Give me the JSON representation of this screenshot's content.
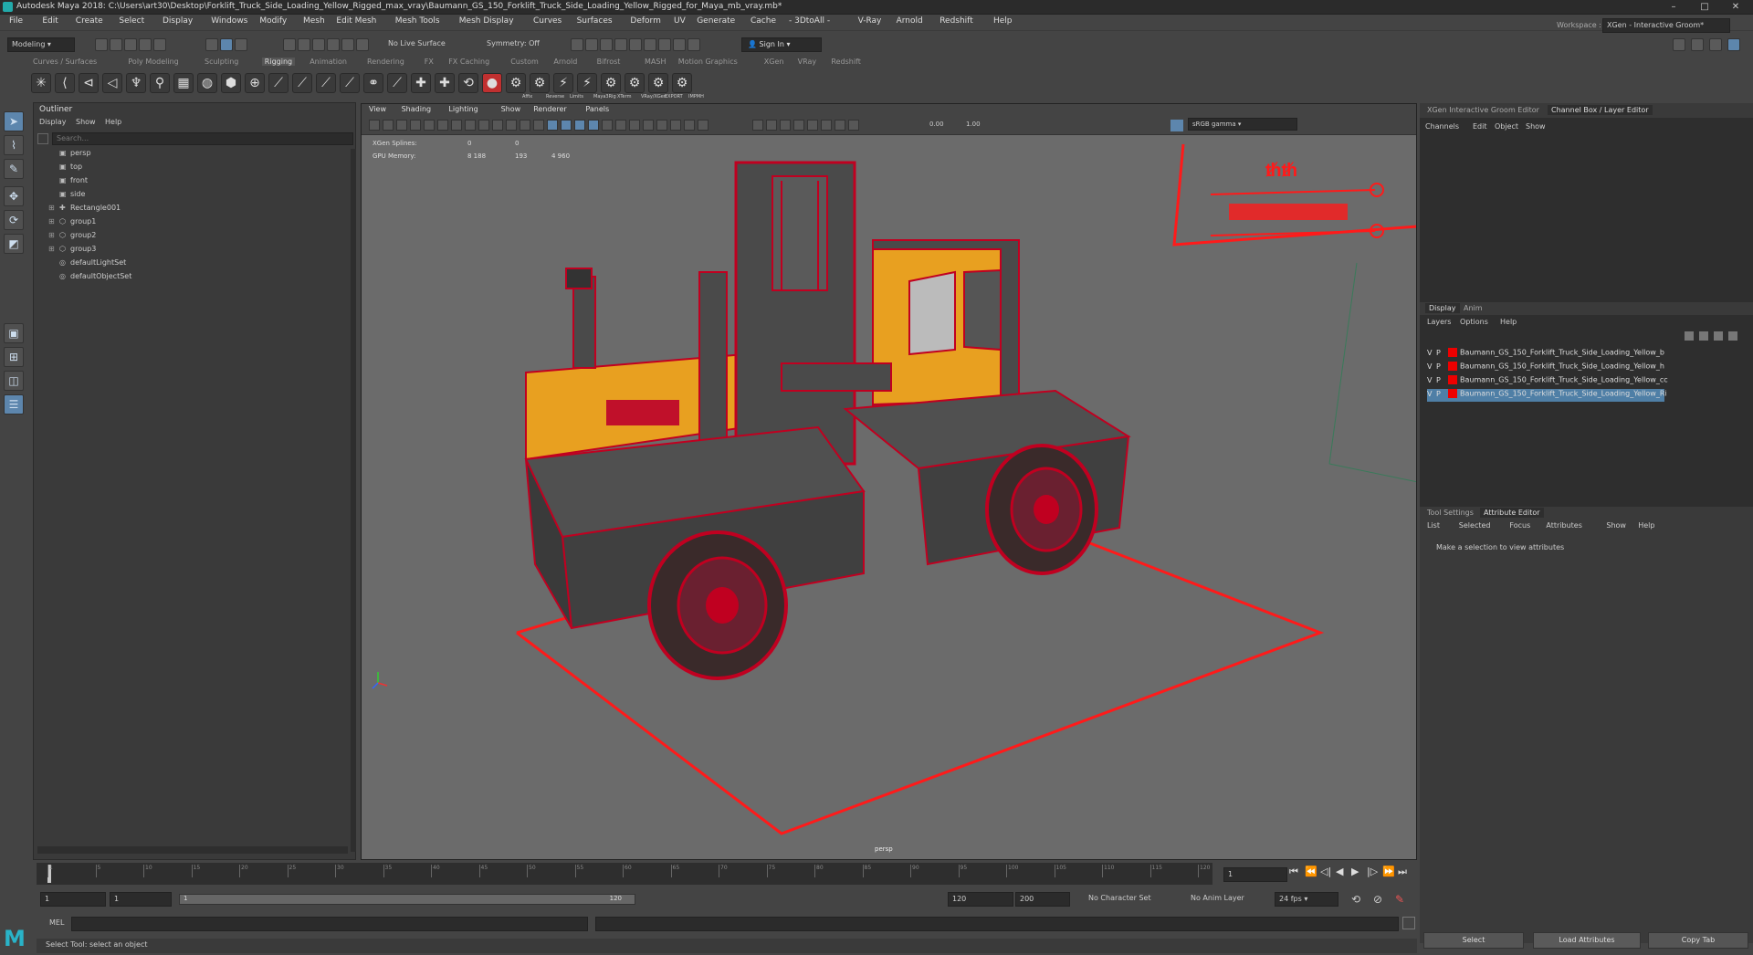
{
  "title": "Autodesk Maya 2018: C:\\Users\\art30\\Desktop\\Forklift_Truck_Side_Loading_Yellow_Rigged_max_vray\\Baumann_GS_150_Forklift_Truck_Side_Loading_Yellow_Rigged_for_Maya_mb_vray.mb*",
  "window_buttons": [
    "–",
    "□",
    "✕"
  ],
  "menu": [
    "File",
    "Edit",
    "Create",
    "Select",
    "Display",
    "Windows",
    "Modify",
    "Mesh",
    "Edit Mesh",
    "Mesh Tools",
    "Mesh Display",
    "Curves",
    "Surfaces",
    "Deform",
    "UV",
    "Generate",
    "Cache",
    "- 3DtoAll -",
    "V-Ray",
    "Arnold",
    "Redshift",
    "Help"
  ],
  "status": {
    "mode": "Modeling",
    "live_surface": "No Live Surface",
    "symmetry": "Symmetry: Off",
    "sign_in": "Sign In",
    "workspace_label": "Workspace :",
    "workspace": "XGen - Interactive Groom*"
  },
  "shelf_tabs": [
    "Curves / Surfaces",
    "Poly Modeling",
    "Sculpting",
    "Rigging",
    "Animation",
    "Rendering",
    "FX",
    "FX Caching",
    "Custom",
    "Arnold",
    "Bifrost",
    "MASH",
    "Motion Graphics",
    "XGen",
    "VRay",
    "Redshift"
  ],
  "shelf_active": "Rigging",
  "shelf_icon_labels": [
    "Affix",
    "Reverse",
    "Limits",
    "Maya3Rig",
    "XTerm",
    "VRay/XGen",
    "EXPORT",
    "IMPMH"
  ],
  "outliner": {
    "title": "Outliner",
    "menu": [
      "Display",
      "Show",
      "Help"
    ],
    "search_placeholder": "Search...",
    "items": [
      {
        "label": "persp",
        "expand": "",
        "icon": "▣"
      },
      {
        "label": "top",
        "expand": "",
        "icon": "▣"
      },
      {
        "label": "front",
        "expand": "",
        "icon": "▣"
      },
      {
        "label": "side",
        "expand": "",
        "icon": "▣"
      },
      {
        "label": "Rectangle001",
        "expand": "⊞",
        "icon": "✚"
      },
      {
        "label": "group1",
        "expand": "⊞",
        "icon": "⬡"
      },
      {
        "label": "group2",
        "expand": "⊞",
        "icon": "⬡"
      },
      {
        "label": "group3",
        "expand": "⊞",
        "icon": "⬡"
      },
      {
        "label": "defaultLightSet",
        "expand": "",
        "icon": "◎"
      },
      {
        "label": "defaultObjectSet",
        "expand": "",
        "icon": "◎"
      }
    ]
  },
  "viewport": {
    "menu": [
      "View",
      "Shading",
      "Lighting",
      "Show",
      "Renderer",
      "Panels"
    ],
    "exposure": "0.00",
    "gamma": "1.00",
    "color_space": "sRGB gamma",
    "hud": [
      {
        "label": "XGen Splines:",
        "a": "0",
        "b": "0",
        "c": ""
      },
      {
        "label": "GPU Memory:",
        "a": "8 188",
        "b": "193",
        "c": "4 960"
      }
    ],
    "camera": "persp"
  },
  "right_panel": {
    "tabs": [
      "XGen Interactive Groom Editor",
      "Channel Box / Layer Editor"
    ],
    "active_tab": "Channel Box / Layer Editor",
    "channel_menu": [
      "Channels",
      "Edit",
      "Object",
      "Show"
    ],
    "layer_tabs": [
      "Display",
      "Anim"
    ],
    "layer_menu": [
      "Layers",
      "Options",
      "Help"
    ],
    "layers": [
      {
        "v": "V",
        "p": "P",
        "name": "Baumann_GS_150_Forklift_Truck_Side_Loading_Yellow_b"
      },
      {
        "v": "V",
        "p": "P",
        "name": "Baumann_GS_150_Forklift_Truck_Side_Loading_Yellow_h"
      },
      {
        "v": "V",
        "p": "P",
        "name": "Baumann_GS_150_Forklift_Truck_Side_Loading_Yellow_cc"
      },
      {
        "v": "V",
        "p": "P",
        "name": "Baumann_GS_150_Forklift_Truck_Side_Loading_Yellow_Ri"
      }
    ],
    "attr_tabs": [
      "Tool Settings",
      "Attribute Editor"
    ],
    "attr_menu": [
      "List",
      "Selected",
      "Focus",
      "Attributes",
      "Show",
      "Help"
    ],
    "attr_message": "Make a selection to view attributes",
    "bottom_buttons": [
      "Select",
      "Load Attributes",
      "Copy Tab"
    ]
  },
  "timeline": {
    "ticks": [
      "1",
      "5",
      "10",
      "15",
      "20",
      "25",
      "30",
      "35",
      "40",
      "45",
      "50",
      "55",
      "60",
      "65",
      "70",
      "75",
      "80",
      "85",
      "90",
      "95",
      "100",
      "105",
      "110",
      "115",
      "120"
    ],
    "current_frame": "1"
  },
  "range": {
    "start": "1",
    "start2": "1",
    "slider_start": "1",
    "slider_end": "120",
    "end": "120",
    "end2": "200",
    "character_set": "No Character Set",
    "anim_layer": "No Anim Layer",
    "fps": "24 fps"
  },
  "cmd": {
    "label": "MEL"
  },
  "help_line": "Select Tool: select an object",
  "colors": {
    "wire": "#e0002a",
    "body": "#e8a020",
    "panel": "#3a3a3a",
    "bg": "#444444"
  }
}
